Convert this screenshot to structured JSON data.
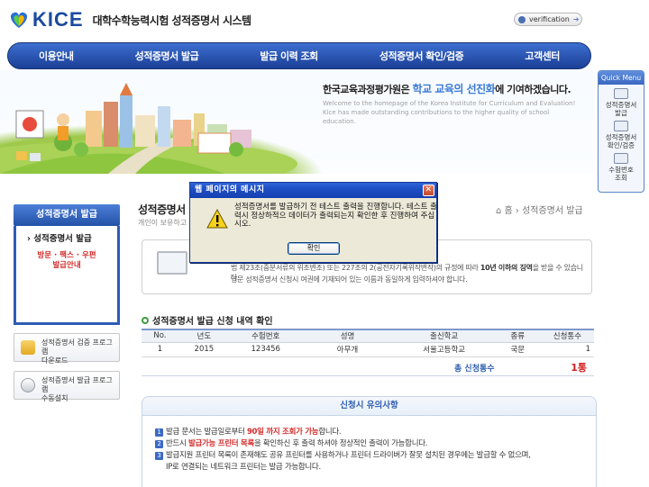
{
  "header": {
    "logo_text": "KICE",
    "system_title": "대학수학능력시험 성적증명서 시스템",
    "verification_label": "verification"
  },
  "nav": {
    "items": [
      "이용안내",
      "성적증명서 발급",
      "발급 이력 조회",
      "성적증명서 확인/검증",
      "고객센터"
    ]
  },
  "banner": {
    "slogan_pre": "한국교육과정평가원은 ",
    "slogan_highlight": "학교 교육의 선진화",
    "slogan_post": "에 기여하겠습니다.",
    "slogan_en_1": "Welcome to the homepage of the Korea Institute for Curriculum and Evaluation!",
    "slogan_en_2": "Kice has made outstanding contributions to the higher quality of school education."
  },
  "quick_menu": {
    "title": "Quick Menu",
    "items": [
      "성적증명서\n발급",
      "성적증명서\n확인/검증",
      "수험번호\n조회"
    ]
  },
  "left_menu": {
    "header": "성적증명서 발급",
    "item1": "› 성적증명서 발급",
    "item2_line1": "방문 · 팩스 · 우편",
    "item2_line2": "발급안내",
    "btn1_line1": "성적증명서 검증 프로그램",
    "btn1_line2": "다운로드",
    "btn2_line1": "성적증명서 발급 프로그램",
    "btn2_line2": "수동설치"
  },
  "content": {
    "title": "성적증명서 발",
    "title_sub": "개인이 보유하고 있",
    "breadcrumb": "⌂ 홈 › 성적증명서 발급",
    "info_line1_pre": "법 제23조(중분서류의 위조변조) 또는 227조의 2(공전자기록위작변작)의 규정에 따라 ",
    "info_line1_bold": "10년 이하의 징역",
    "info_line1_post": "을 받을 수 있습니다.",
    "info_line2": "영문 성적증명서 신청시 여권에 기재되어 있는 이름과 동일하게 입력하셔야 합니다.",
    "section_title": "성적증명서 발급 신청 내역 확인"
  },
  "table": {
    "headers": [
      "No.",
      "년도",
      "수험번호",
      "성명",
      "출신학교",
      "종류",
      "신청통수"
    ],
    "rows": [
      [
        "1",
        "2015",
        "123456",
        "아무개",
        "서울고등학교",
        "국문",
        "1"
      ]
    ],
    "total_label": "총 신청통수",
    "total_value": "1통"
  },
  "notice": {
    "title": "신청시 유의사항",
    "n1": "1",
    "n2": "2",
    "n3": "3",
    "line1_pre": "발급 문서는 발급일로부터 ",
    "line1_red": "90일 까지 조회가 가능",
    "line1_post": "합니다.",
    "line2_pre": "반드시 ",
    "line2_red": "발급가능 프린터 목록",
    "line2_post": "을 확인하신 후 출력 하셔야 정상적인 출력이 가능합니다.",
    "line3": "발급지원 프린터 목록이 존재해도 공유 프린터를 사용하거나 프린터 드라이버가 잘못 설치된 경우에는 발급할 수 없으며,",
    "line3b": "IP로 연결되는 네트워크 프린터는 발급 가능합니다."
  },
  "dialog": {
    "title": "웹 페이지의 메시지",
    "message": "성적증명서를 발급하기 전 테스트 출력을 진행합니다. 테스트 출력시 정상하적으 데이터가 출력되는지 확인한 후 진행하여 주십시오.",
    "ok_label": "확인"
  },
  "colors": {
    "nav": "#2a55b5",
    "accent_red": "#d32b2b",
    "accent_blue": "#2e5db0"
  }
}
